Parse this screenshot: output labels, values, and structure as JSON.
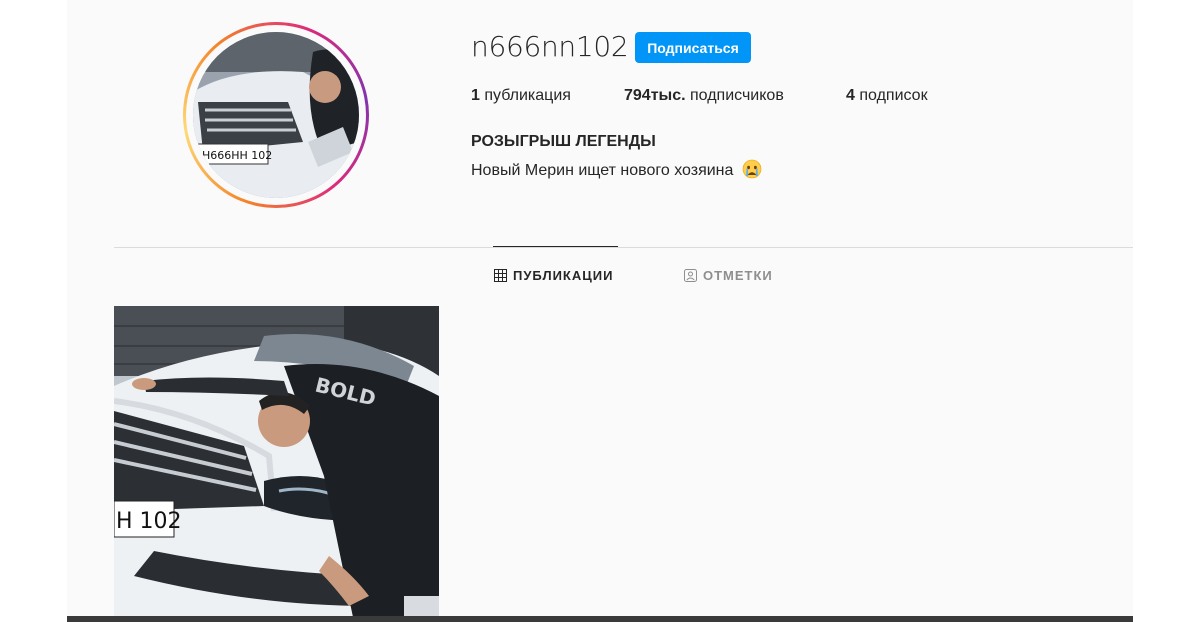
{
  "profile": {
    "username": "n666nn102",
    "follow_label": "Подписаться",
    "stats": [
      {
        "value": "1",
        "label": " публикация"
      },
      {
        "value": "794тыс.",
        "label": " подписчиков"
      },
      {
        "value": "4",
        "label": " подписок"
      }
    ],
    "bio_title": "РОЗЫГРЫШ ЛЕГЕНДЫ",
    "bio_text": "Новый Мерин ищет нового хозяина",
    "bio_emoji": "crying-face-emoji",
    "plate_text": "Н666НН 102",
    "plate_text_post": "Н 102"
  },
  "tabs": [
    {
      "label": "ПУБЛИКАЦИИ",
      "icon": "grid-icon",
      "active": true
    },
    {
      "label": "ОТМЕТКИ",
      "icon": "tagged-user-icon",
      "active": false
    }
  ],
  "posts": [
    {
      "description_icon": "post-photo"
    }
  ],
  "colors": {
    "accent": "#0095f6",
    "text": "#262626",
    "muted": "#8e8e8e",
    "divider": "#dbdbdb",
    "background": "#fafafa"
  }
}
